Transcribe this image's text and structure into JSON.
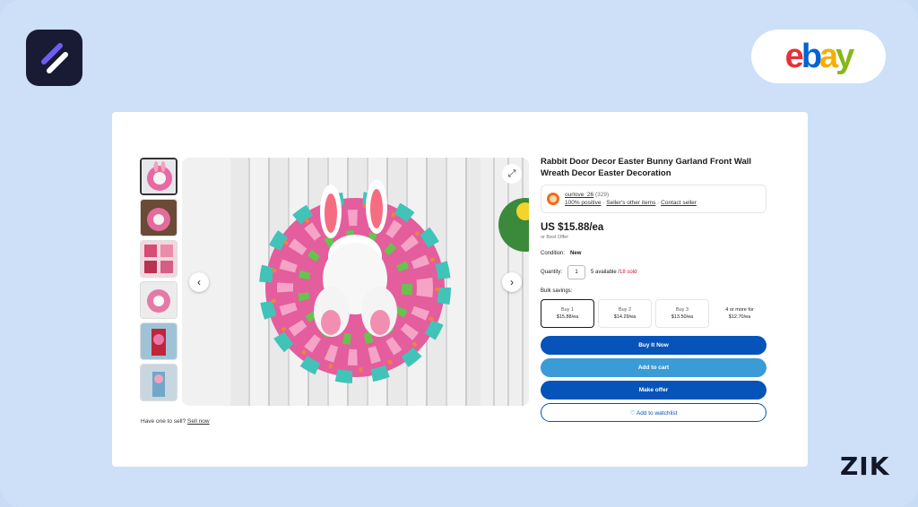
{
  "brand": {
    "ebay_letters": [
      "e",
      "b",
      "a",
      "y"
    ],
    "ebay_colors": [
      "#e53238",
      "#0064d2",
      "#f5af02",
      "#86b817"
    ],
    "watermark": "ZIK"
  },
  "gallery": {
    "prev_icon": "chevron-left-icon",
    "next_icon": "chevron-right-icon",
    "expand_icon": "expand-icon",
    "thumbnail_count": 6
  },
  "sell_prompt": {
    "text": "Have one to sell?",
    "link": "Sell now"
  },
  "listing": {
    "title": "Rabbit Door Decor Easter Bunny Garland Front Wall Wreath Decor Easter Decoration",
    "seller": {
      "name": "ourlove_26",
      "feedback_count": "(329)",
      "positive": "100% positive",
      "other_items": "Seller's other items",
      "contact": "Contact seller"
    },
    "price": "US $15.88/ea",
    "best_offer": "or Best Offer",
    "condition_label": "Condition:",
    "condition_value": "New",
    "quantity_label": "Quantity:",
    "quantity_value": "1",
    "available": "5 available / ",
    "sold": "18 sold",
    "bulk_label": "Bulk savings:",
    "bulk": [
      {
        "tier": "Buy 1",
        "price": "$15.88/ea"
      },
      {
        "tier": "Buy 2",
        "price": "$14.29/ea"
      },
      {
        "tier": "Buy 3",
        "price": "$13.50/ea"
      },
      {
        "tier": "4 or more for",
        "price": "$12.70/ea"
      }
    ],
    "buy_now": "Buy It Now",
    "add_to_cart": "Add to cart",
    "make_offer": "Make offer",
    "watchlist": "♡ Add to watchlist"
  }
}
